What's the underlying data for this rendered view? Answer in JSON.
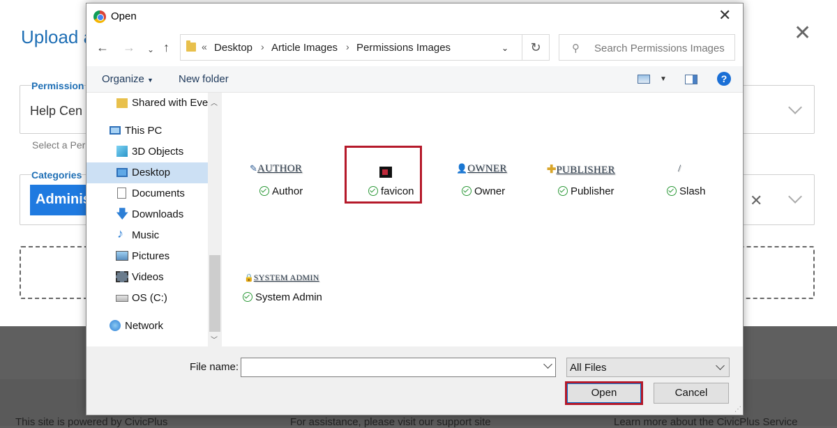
{
  "background": {
    "modal_title": "Upload a",
    "permission_label": "Permission",
    "permission_value": "Help Cen",
    "permission_hint": "Select a Per",
    "categories_label": "Categories",
    "category_chip": "Administ",
    "footer": {
      "left": "This site is powered by CivicPlus",
      "center": "For assistance, please visit our support site",
      "right": "Learn more about the CivicPlus Service"
    }
  },
  "dialog": {
    "title": "Open",
    "address": {
      "overflow": "«",
      "crumbs": [
        "Desktop",
        "Article Images",
        "Permissions Images"
      ]
    },
    "search_placeholder": "Search Permissions Images",
    "toolbar": {
      "organize": "Organize",
      "new_folder": "New folder"
    },
    "nav_items": [
      {
        "label": "Shared with Ever",
        "icon": "folder-icon"
      },
      {
        "label": "This PC",
        "icon": "computer-icon"
      },
      {
        "label": "3D Objects",
        "icon": "cube-icon"
      },
      {
        "label": "Desktop",
        "icon": "desktop-icon",
        "selected": true
      },
      {
        "label": "Documents",
        "icon": "document-icon"
      },
      {
        "label": "Downloads",
        "icon": "download-icon"
      },
      {
        "label": "Music",
        "icon": "music-icon"
      },
      {
        "label": "Pictures",
        "icon": "pictures-icon"
      },
      {
        "label": "Videos",
        "icon": "film-icon"
      },
      {
        "label": "OS (C:)",
        "icon": "drive-icon"
      },
      {
        "label": "Network",
        "icon": "network-icon"
      }
    ],
    "files": [
      {
        "name": "Author",
        "preview": "AUTHOR",
        "icon": "pencil-icon"
      },
      {
        "name": "favicon",
        "preview": "",
        "icon": "favicon-icon",
        "highlighted": true
      },
      {
        "name": "Owner",
        "preview": "OWNER",
        "icon": "user-icon"
      },
      {
        "name": "Publisher",
        "preview": "PUBLISHER",
        "icon": "plus-icon"
      },
      {
        "name": "Slash",
        "preview": "/",
        "icon": ""
      },
      {
        "name": "System Admin",
        "preview": "SYSTEM ADMIN",
        "icon": "lock-icon"
      }
    ],
    "file_name_label": "File name:",
    "file_name_value": "",
    "file_type": "All Files",
    "open_button": "Open",
    "cancel_button": "Cancel",
    "accent": "#b5192a"
  }
}
